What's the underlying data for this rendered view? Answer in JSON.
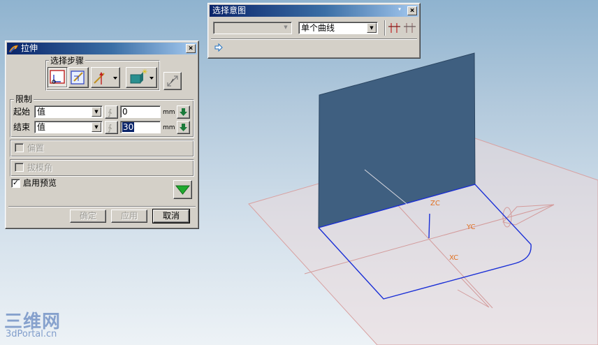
{
  "extrude_dialog": {
    "title": "拉伸",
    "close_glyph": "×",
    "selection_steps_label": "选择步骤",
    "limits": {
      "group_label": "限制",
      "start": {
        "label": "起始",
        "mode": "值",
        "value": "0",
        "unit": "mm"
      },
      "end": {
        "label": "结束",
        "mode": "值",
        "value": "30",
        "unit": "mm"
      }
    },
    "offset_label": "偏置",
    "draft_label": "拔模角",
    "preview": {
      "label": "启用预览",
      "checked": true,
      "check_glyph": "✓"
    },
    "buttons": {
      "ok": "确定",
      "apply": "应用",
      "cancel": "取消"
    }
  },
  "selection_intent": {
    "title": "选择意图",
    "menu_glyph": "▾",
    "close_glyph": "×",
    "filter_value": "",
    "curve_rule": "单个曲线"
  },
  "viewport": {
    "axis_labels": {
      "z": "ZC",
      "y": "YC",
      "x": "XC"
    },
    "colors": {
      "sheet": "#3f5f80",
      "plane": "#e9d9dc",
      "plane_edge": "#d99a9a",
      "curve": "#1a2fd6",
      "axis_label": "#e07020"
    }
  },
  "watermark": {
    "cn": "三维网",
    "en": "3dPortal.cn"
  },
  "colors": {
    "title_active": "#0a246a",
    "dialog_bg": "#d4d0c8",
    "preview_green": "#1faa2f"
  }
}
